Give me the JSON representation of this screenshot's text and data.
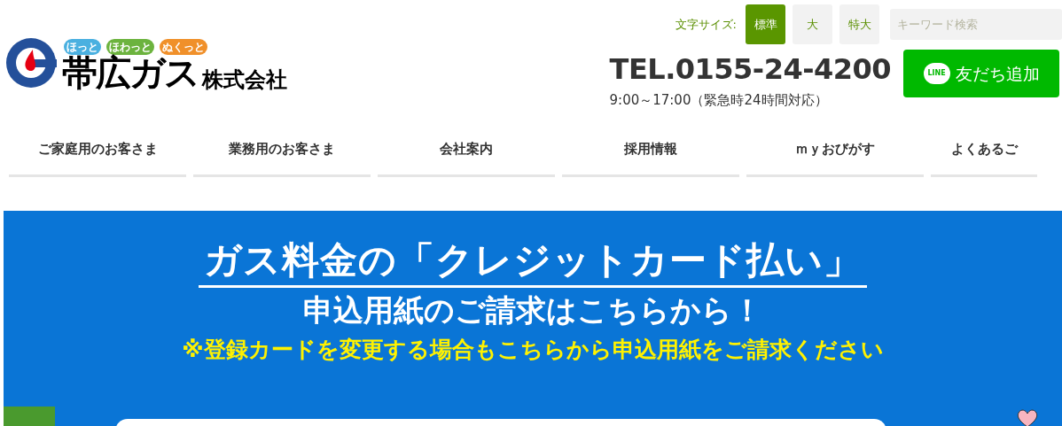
{
  "logo": {
    "taglines": [
      {
        "text": "ほっと",
        "color": "#4ab0e0"
      },
      {
        "text": "ほわっと",
        "color": "#6cb33e"
      },
      {
        "text": "ぬくっと",
        "color": "#f0902a"
      }
    ],
    "name": "帯広ガス",
    "suffix": "株式会社"
  },
  "font_size": {
    "label": "文字サイズ:",
    "options": [
      {
        "label": "標準",
        "selected": true
      },
      {
        "label": "大",
        "selected": false
      },
      {
        "label": "特大",
        "selected": false
      }
    ]
  },
  "search": {
    "placeholder": "キーワード検索"
  },
  "phone": "TEL.0155-24-4200",
  "hours": "9:00～17:00（緊急時24時間対応）",
  "line_button": {
    "badge": "LINE",
    "label": "友だち追加"
  },
  "nav": [
    "ご家庭用のお客さま",
    "業務用のお客さま",
    "会社案内",
    "採用情報",
    "ｍｙおびがす",
    "よくあるご"
  ],
  "banner": {
    "title": "ガス料金の「クレジットカード払い」",
    "subtitle": "申込用紙のご請求はこちらから！",
    "note": "※登録カードを変更する場合もこちらから申込用紙をご請求ください"
  }
}
